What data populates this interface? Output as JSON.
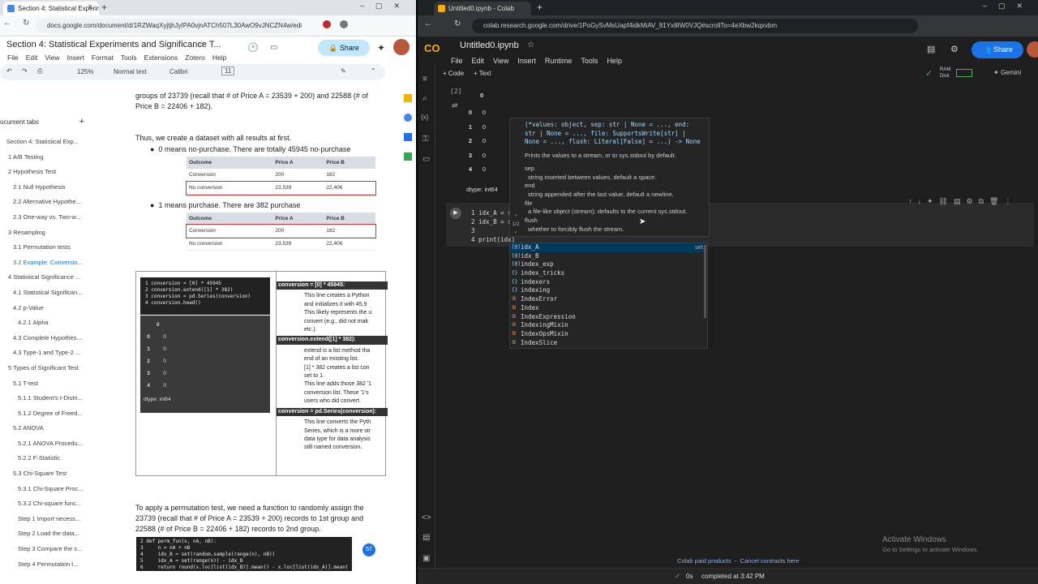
{
  "left": {
    "tabs": [
      {
        "label": "Section 4: Statistical Experimen",
        "close": "✕"
      },
      {
        "label": "+"
      }
    ],
    "url": "docs.google.com/document/d/1RZWaqXyjtjhJyIPA0vjnATCh507L30AwO9vJNCZN4w/edi...",
    "doc_title": "Section 4: Statistical Experiments and Significance T...",
    "menu": [
      "File",
      "Edit",
      "View",
      "Insert",
      "Format",
      "Tools",
      "Extensions",
      "Zotero",
      "Help"
    ],
    "share_label": "Share",
    "toolbar": {
      "zoom": "125%",
      "style": "Normal text",
      "font": "Calibri",
      "size": "11"
    },
    "outline_header": "ocument tabs",
    "outline": [
      "Section 4: Statistical Exp...",
      "1 A/B Testing",
      "2 Hypothesis Test",
      "2.1 Null Hypothesis",
      "2.2 Alternative Hypothe...",
      "2.3 One-way vs. Two-w...",
      "3 Resampling",
      "3.1 Permutation tests",
      "3.2 Example: Conversio...",
      "4 Statistical Significance ...",
      "4.1 Statistical Significan...",
      "4.2 p-Value",
      "4.2.1 Alpha",
      "4.3 Complete Hypothes...",
      "4.3 Type-1 and Type-2 ...",
      "5 Types of Significant Test",
      "5.1 T-test",
      "5.1.1 Student's t-Distri...",
      "5.1.2 Degree of Freed...",
      "5.2 ANOVA",
      "5.2.1 ANOVA Procedu...",
      "5.2.2 F-Statistic",
      "5.3 Chi-Square Test",
      "5.3.1 Chi-Square Proc...",
      "5.3.2 Chi-square func...",
      "Step 1 Import necess...",
      "Step 2 Load the data...",
      "Step 3 Compare the s...",
      "Step 4 Permutation t..."
    ],
    "body": {
      "p1": "groups of 23739 (recall that # of Price A = 23539 + 200) and 22588 (# of Price B = 22406 + 182).",
      "p2": "Thus, we create a dataset with all results at first.",
      "b1": "0 means no-purchase. There are totally 45945 no-purchase",
      "b2": "1 means purchase. There are 382 purchase",
      "table_headers": [
        "Outcome",
        "Price A",
        "Price B"
      ],
      "table_rows": [
        [
          "Conversion",
          "200",
          "182"
        ],
        [
          "No conversion",
          "23,539",
          "22,406"
        ]
      ],
      "code_lines": [
        "1 conversion = [0] * 45945",
        "2 conversion.extend([1] * 382)",
        "3 conversion = pd.Series(conversion)",
        "4 conversion.head()"
      ],
      "out_header": "0",
      "out_rows": [
        [
          "0",
          "0"
        ],
        [
          "1",
          "0"
        ],
        [
          "2",
          "0"
        ],
        [
          "3",
          "0"
        ],
        [
          "4",
          "0"
        ]
      ],
      "dtype": "dtype: int64",
      "expl": [
        {
          "head": "conversion = [0] * 45945:",
          "items": [
            "This line creates a Python",
            "and initializes it with 45,9",
            "This likely represents the u",
            "convert (e.g., did not mak",
            "etc.)."
          ]
        },
        {
          "head": "conversion.extend([1] * 382):",
          "items": [
            "extend is a list method tha",
            "end of an existing list.",
            "[1] * 382 creates a list con",
            "set to 1.",
            "This line adds those 382 '1",
            "conversion list. These '1's",
            "users who did convert."
          ]
        },
        {
          "head": "conversion = pd.Series(conversion):",
          "items": [
            "This line converts the Pyth",
            "Series, which is a more str",
            "data type for data analysis",
            "still named conversion."
          ]
        }
      ],
      "p3": "To apply a permutation test, we need a function to randomly assign the 23739 (recall that # of Price A = 23539 + 200) records to 1st group and 22588 (# of Price B = 22406 + 182) records to 2nd group.",
      "code2": [
        "2 def perm_fun(x, nA, nB):",
        "3     n = nA + nB",
        "4     idx_B = set(random.sample(range(n), nB))",
        "5     idx_A = set(range(n)) - idx_B",
        "6     return round(x.loc[list(idx_B)].mean() - x.loc[list(idx_A)].mean(),4)"
      ],
      "badge": "57"
    }
  },
  "right": {
    "tabs": [
      {
        "label": "Untitled0.ipynb - Colab"
      },
      {
        "label": "+"
      }
    ],
    "url": "colab.research.google.com/drive/1PoGySvMsUapf4idkMiAV_81Yx8IW0VJQ#scrollTo=4eXbw2kqxvbm",
    "logo": "CO",
    "notebook_title": "Untitled0.ipynb",
    "menu": [
      "File",
      "Edit",
      "View",
      "Insert",
      "Runtime",
      "Tools",
      "Help"
    ],
    "share_label": "Share",
    "add_code": "+ Code",
    "add_text": "+ Text",
    "ram": "RAM",
    "disk": "Disk",
    "gemini": "Gemini",
    "exec_count": "[2]",
    "out_header": "0",
    "out_rows": [
      [
        "0",
        "0"
      ],
      [
        "1",
        "0"
      ],
      [
        "2",
        "0"
      ],
      [
        "3",
        "0"
      ],
      [
        "4",
        "0"
      ]
    ],
    "dtype": "dtype: int64",
    "code_lines": [
      "1 idx_A = s",
      "2 idx_B = s",
      "3",
      "4 print(idx)"
    ],
    "tooltip": {
      "signature": "(*values: object, sep: str | None = ..., end: str | None = ..., file: SupportsWrite[str] | None = ..., flush: Literal[False] = ...) -> None",
      "desc": "Prints the values to a stream, or to sys.stdout by default.",
      "pager": "1/2",
      "params": [
        {
          "name": "sep",
          "desc": "string inserted between values, default a space."
        },
        {
          "name": "end",
          "desc": "string appended after the last value, default a newline."
        },
        {
          "name": "file",
          "desc": "a file-like object (stream); defaults to the current sys.stdout."
        },
        {
          "name": "flush",
          "desc": "whether to forcibly flush the stream."
        }
      ]
    },
    "autocomplete": [
      {
        "label": "idx_A",
        "kind": "[@]",
        "detail": "set"
      },
      {
        "label": "idx_B",
        "kind": "[@]",
        "detail": ""
      },
      {
        "label": "index_exp",
        "kind": "[@]",
        "detail": ""
      },
      {
        "label": "index_tricks",
        "kind": "{}",
        "detail": ""
      },
      {
        "label": "indexers",
        "kind": "{}",
        "detail": ""
      },
      {
        "label": "indexing",
        "kind": "{}",
        "detail": ""
      },
      {
        "label": "IndexError",
        "kind": "ꕥ",
        "detail": ""
      },
      {
        "label": "Index",
        "kind": "ꕥ",
        "detail": ""
      },
      {
        "label": "IndexExpression",
        "kind": "ꕥ",
        "detail": ""
      },
      {
        "label": "IndexingMixin",
        "kind": "ꕥ",
        "detail": ""
      },
      {
        "label": "IndexOpsMixin",
        "kind": "ꕥ",
        "detail": ""
      },
      {
        "label": "IndexSlice",
        "kind": "ꕥ",
        "detail": ""
      }
    ],
    "activate": {
      "title": "Activate Windows",
      "sub": "Go to Settings to activate Windows."
    },
    "footer_links": "Colab paid products  -  Cancel contracts here",
    "status": {
      "time": "0s",
      "text": "completed at 3:42 PM"
    }
  }
}
